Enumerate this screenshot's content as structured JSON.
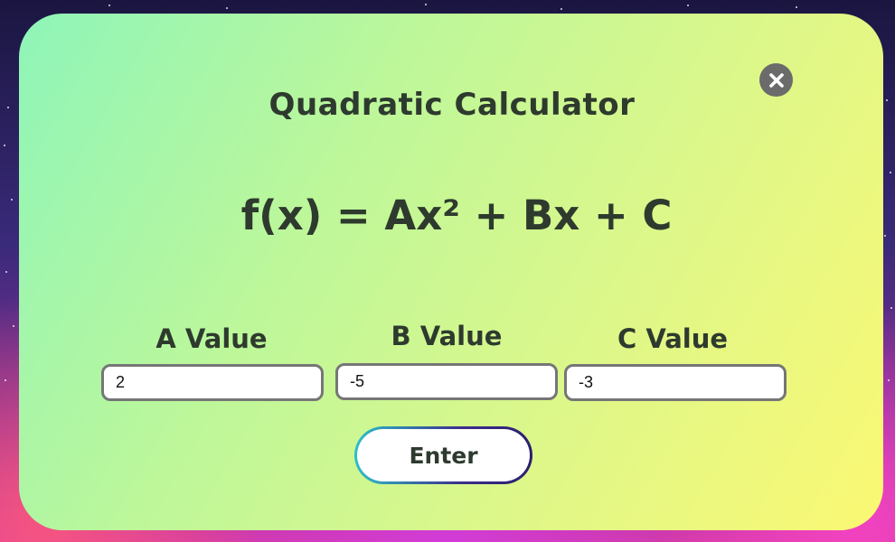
{
  "dialog": {
    "title": "Quadratic Calculator",
    "formula": "f(x) = Ax² + Bx + C",
    "close_icon": "close-icon"
  },
  "fields": {
    "a": {
      "label": "A Value",
      "value": "2"
    },
    "b": {
      "label": "B Value",
      "value": "-5"
    },
    "c": {
      "label": "C Value",
      "value": "-3"
    }
  },
  "actions": {
    "enter_label": "Enter"
  },
  "colors": {
    "panel_gradient_start": "#8ef5b9",
    "panel_gradient_end": "#fbf873",
    "text": "#2e3a2e",
    "close_button": "#6b6b6b",
    "input_border": "#767676",
    "button_border_start": "#2ec0c8",
    "button_border_end": "#2a1f6e"
  }
}
